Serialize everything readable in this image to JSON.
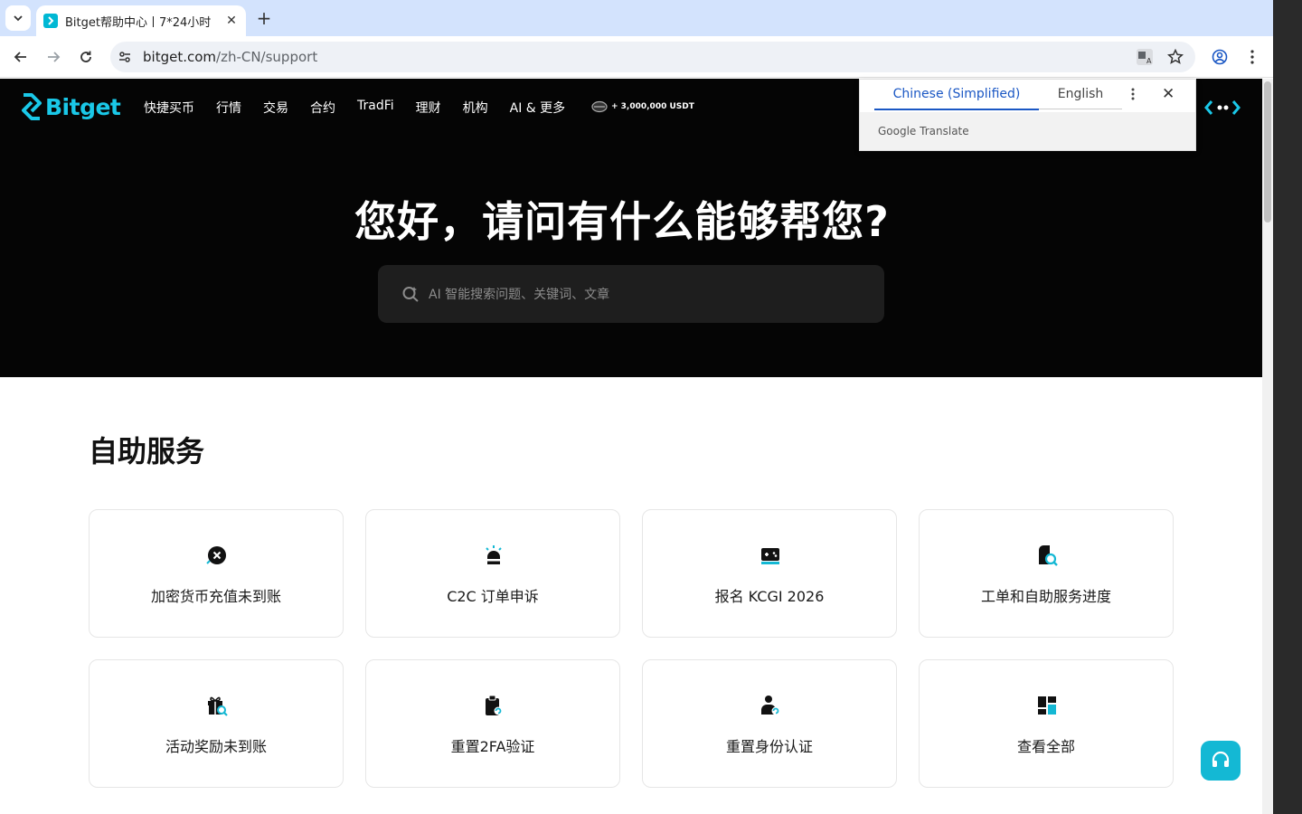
{
  "browser": {
    "tab_title": "Bitget帮助中心丨7*24小时",
    "url_host": "bitget.com",
    "url_path": "/zh-CN/support"
  },
  "header": {
    "logo_text": "Bitget",
    "nav": [
      "快捷买币",
      "行情",
      "交易",
      "合约",
      "TradFi",
      "理财",
      "机构",
      "AI & 更多"
    ],
    "promo_text": "+ 3,000,000 USDT"
  },
  "translate": {
    "tab_active": "Chinese (Simplified)",
    "tab_inactive": "English",
    "brand_google": "Google",
    "brand_translate": "Translate"
  },
  "hero": {
    "title": "您好，请问有什么能够帮您?",
    "search_placeholder": "AI 智能搜索问题、关键词、文章"
  },
  "self_service": {
    "title": "自助服务",
    "cards": [
      {
        "label": "加密货币充值未到账",
        "icon": "x-circle-icon"
      },
      {
        "label": "C2C 订单申诉",
        "icon": "siren-icon"
      },
      {
        "label": "报名 KCGI 2026",
        "icon": "gamepad-icon"
      },
      {
        "label": "工单和自助服务进度",
        "icon": "ticket-search-icon"
      },
      {
        "label": "活动奖励未到账",
        "icon": "gift-search-icon"
      },
      {
        "label": "重置2FA验证",
        "icon": "clipboard-reset-icon"
      },
      {
        "label": "重置身份认证",
        "icon": "user-reset-icon"
      },
      {
        "label": "查看全部",
        "icon": "grid-icon"
      }
    ]
  },
  "colors": {
    "brand": "#1ac8e8",
    "accent": "#14b8d4",
    "header_bg": "#050505"
  }
}
